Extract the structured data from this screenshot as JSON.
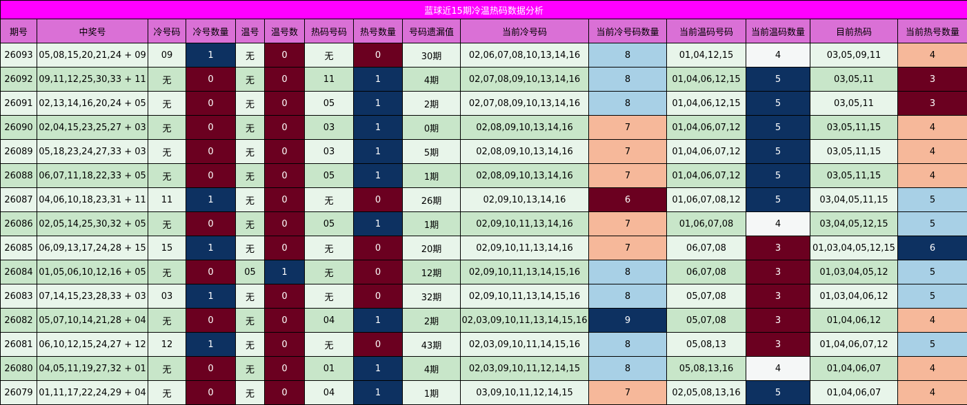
{
  "title": "蓝球近15期冷温热码数据分析",
  "headers": [
    "期号",
    "中奖号",
    "冷号码",
    "冷号数量",
    "温号",
    "温号数",
    "热码号码",
    "热号数量",
    "号码遗漏值",
    "当前冷号码",
    "当前冷号码数量",
    "当前温码号码",
    "当前温码数量",
    "目前热码",
    "当前热号数量"
  ],
  "colors": {
    "title_bar": "#ff00ff",
    "header_bar": "#da70d6",
    "row_light": "#e8f5ea",
    "row_alt": "#c8e6c9",
    "navy": "#0d3161",
    "maroon": "#6b0020",
    "light_blue": "#a8d0e6",
    "peach": "#f6b89a",
    "white": "#f5f7f7"
  },
  "rows": [
    {
      "issue": "26093",
      "draw": "05,08,15,20,21,24 + 09",
      "cold": "09",
      "cold_count": "1",
      "warm": "无",
      "warm_count": "0",
      "hot": "无",
      "hot_count": "0",
      "omit": "30期",
      "cur_cold": "02,06,07,08,10,13,14,16",
      "cur_cold_count": "8",
      "cur_warm": "01,04,12,15",
      "cur_warm_count": "4",
      "cur_hot": "03,05,09,11",
      "cur_hot_count": "4",
      "colors": {
        "cold_count": "navy",
        "warm_count": "maroon",
        "hot_count": "maroon",
        "cur_cold_count": "light",
        "cur_warm_count": "white",
        "cur_hot_count": "peach"
      }
    },
    {
      "issue": "26092",
      "draw": "09,11,12,25,30,33 + 11",
      "cold": "无",
      "cold_count": "0",
      "warm": "无",
      "warm_count": "0",
      "hot": "11",
      "hot_count": "1",
      "omit": "4期",
      "cur_cold": "02,07,08,09,10,13,14,16",
      "cur_cold_count": "8",
      "cur_warm": "01,04,06,12,15",
      "cur_warm_count": "5",
      "cur_hot": "03,05,11",
      "cur_hot_count": "3",
      "colors": {
        "cold_count": "maroon",
        "warm_count": "maroon",
        "hot_count": "navy",
        "cur_cold_count": "light",
        "cur_warm_count": "navy",
        "cur_hot_count": "maroon"
      }
    },
    {
      "issue": "26091",
      "draw": "02,13,14,16,20,24 + 05",
      "cold": "无",
      "cold_count": "0",
      "warm": "无",
      "warm_count": "0",
      "hot": "05",
      "hot_count": "1",
      "omit": "2期",
      "cur_cold": "02,07,08,09,10,13,14,16",
      "cur_cold_count": "8",
      "cur_warm": "01,04,06,12,15",
      "cur_warm_count": "5",
      "cur_hot": "03,05,11",
      "cur_hot_count": "3",
      "colors": {
        "cold_count": "maroon",
        "warm_count": "maroon",
        "hot_count": "navy",
        "cur_cold_count": "light",
        "cur_warm_count": "navy",
        "cur_hot_count": "maroon"
      }
    },
    {
      "issue": "26090",
      "draw": "02,04,15,23,25,27 + 03",
      "cold": "无",
      "cold_count": "0",
      "warm": "无",
      "warm_count": "0",
      "hot": "03",
      "hot_count": "1",
      "omit": "0期",
      "cur_cold": "02,08,09,10,13,14,16",
      "cur_cold_count": "7",
      "cur_warm": "01,04,06,07,12",
      "cur_warm_count": "5",
      "cur_hot": "03,05,11,15",
      "cur_hot_count": "4",
      "colors": {
        "cold_count": "maroon",
        "warm_count": "maroon",
        "hot_count": "navy",
        "cur_cold_count": "peach",
        "cur_warm_count": "navy",
        "cur_hot_count": "peach"
      }
    },
    {
      "issue": "26089",
      "draw": "05,18,23,24,27,33 + 03",
      "cold": "无",
      "cold_count": "0",
      "warm": "无",
      "warm_count": "0",
      "hot": "03",
      "hot_count": "1",
      "omit": "5期",
      "cur_cold": "02,08,09,10,13,14,16",
      "cur_cold_count": "7",
      "cur_warm": "01,04,06,07,12",
      "cur_warm_count": "5",
      "cur_hot": "03,05,11,15",
      "cur_hot_count": "4",
      "colors": {
        "cold_count": "maroon",
        "warm_count": "maroon",
        "hot_count": "navy",
        "cur_cold_count": "peach",
        "cur_warm_count": "navy",
        "cur_hot_count": "peach"
      }
    },
    {
      "issue": "26088",
      "draw": "06,07,11,18,22,33 + 05",
      "cold": "无",
      "cold_count": "0",
      "warm": "无",
      "warm_count": "0",
      "hot": "05",
      "hot_count": "1",
      "omit": "1期",
      "cur_cold": "02,08,09,10,13,14,16",
      "cur_cold_count": "7",
      "cur_warm": "01,04,06,07,12",
      "cur_warm_count": "5",
      "cur_hot": "03,05,11,15",
      "cur_hot_count": "4",
      "colors": {
        "cold_count": "maroon",
        "warm_count": "maroon",
        "hot_count": "navy",
        "cur_cold_count": "peach",
        "cur_warm_count": "navy",
        "cur_hot_count": "peach"
      }
    },
    {
      "issue": "26087",
      "draw": "04,06,10,18,23,31 + 11",
      "cold": "11",
      "cold_count": "1",
      "warm": "无",
      "warm_count": "0",
      "hot": "无",
      "hot_count": "0",
      "omit": "26期",
      "cur_cold": "02,09,10,13,14,16",
      "cur_cold_count": "6",
      "cur_warm": "01,06,07,08,12",
      "cur_warm_count": "5",
      "cur_hot": "03,04,05,11,15",
      "cur_hot_count": "5",
      "colors": {
        "cold_count": "navy",
        "warm_count": "maroon",
        "hot_count": "maroon",
        "cur_cold_count": "maroon",
        "cur_warm_count": "navy",
        "cur_hot_count": "light"
      }
    },
    {
      "issue": "26086",
      "draw": "02,05,14,25,30,32 + 05",
      "cold": "无",
      "cold_count": "0",
      "warm": "无",
      "warm_count": "0",
      "hot": "05",
      "hot_count": "1",
      "omit": "1期",
      "cur_cold": "02,09,10,11,13,14,16",
      "cur_cold_count": "7",
      "cur_warm": "01,06,07,08",
      "cur_warm_count": "4",
      "cur_hot": "03,04,05,12,15",
      "cur_hot_count": "5",
      "colors": {
        "cold_count": "maroon",
        "warm_count": "maroon",
        "hot_count": "navy",
        "cur_cold_count": "peach",
        "cur_warm_count": "white",
        "cur_hot_count": "light"
      }
    },
    {
      "issue": "26085",
      "draw": "06,09,13,17,24,28 + 15",
      "cold": "15",
      "cold_count": "1",
      "warm": "无",
      "warm_count": "0",
      "hot": "无",
      "hot_count": "0",
      "omit": "20期",
      "cur_cold": "02,09,10,11,13,14,16",
      "cur_cold_count": "7",
      "cur_warm": "06,07,08",
      "cur_warm_count": "3",
      "cur_hot": "01,03,04,05,12,15",
      "cur_hot_count": "6",
      "colors": {
        "cold_count": "navy",
        "warm_count": "maroon",
        "hot_count": "maroon",
        "cur_cold_count": "peach",
        "cur_warm_count": "maroon",
        "cur_hot_count": "navy"
      }
    },
    {
      "issue": "26084",
      "draw": "01,05,06,10,12,16 + 05",
      "cold": "无",
      "cold_count": "0",
      "warm": "05",
      "warm_count": "1",
      "hot": "无",
      "hot_count": "0",
      "omit": "12期",
      "cur_cold": "02,09,10,11,13,14,15,16",
      "cur_cold_count": "8",
      "cur_warm": "06,07,08",
      "cur_warm_count": "3",
      "cur_hot": "01,03,04,05,12",
      "cur_hot_count": "5",
      "colors": {
        "cold_count": "maroon",
        "warm_count": "navy",
        "hot_count": "maroon",
        "cur_cold_count": "light",
        "cur_warm_count": "maroon",
        "cur_hot_count": "light"
      }
    },
    {
      "issue": "26083",
      "draw": "07,14,15,23,28,33 + 03",
      "cold": "03",
      "cold_count": "1",
      "warm": "无",
      "warm_count": "0",
      "hot": "无",
      "hot_count": "0",
      "omit": "32期",
      "cur_cold": "02,09,10,11,13,14,15,16",
      "cur_cold_count": "8",
      "cur_warm": "05,07,08",
      "cur_warm_count": "3",
      "cur_hot": "01,03,04,06,12",
      "cur_hot_count": "5",
      "colors": {
        "cold_count": "navy",
        "warm_count": "maroon",
        "hot_count": "maroon",
        "cur_cold_count": "light",
        "cur_warm_count": "maroon",
        "cur_hot_count": "light"
      }
    },
    {
      "issue": "26082",
      "draw": "05,07,10,14,21,28 + 04",
      "cold": "无",
      "cold_count": "0",
      "warm": "无",
      "warm_count": "0",
      "hot": "04",
      "hot_count": "1",
      "omit": "2期",
      "cur_cold": "02,03,09,10,11,13,14,15,16",
      "cur_cold_count": "9",
      "cur_warm": "05,07,08",
      "cur_warm_count": "3",
      "cur_hot": "01,04,06,12",
      "cur_hot_count": "4",
      "colors": {
        "cold_count": "maroon",
        "warm_count": "maroon",
        "hot_count": "navy",
        "cur_cold_count": "navy",
        "cur_warm_count": "maroon",
        "cur_hot_count": "peach"
      }
    },
    {
      "issue": "26081",
      "draw": "06,10,12,15,24,27 + 12",
      "cold": "12",
      "cold_count": "1",
      "warm": "无",
      "warm_count": "0",
      "hot": "无",
      "hot_count": "0",
      "omit": "43期",
      "cur_cold": "02,03,09,10,11,14,15,16",
      "cur_cold_count": "8",
      "cur_warm": "05,08,13",
      "cur_warm_count": "3",
      "cur_hot": "01,04,06,07,12",
      "cur_hot_count": "5",
      "colors": {
        "cold_count": "navy",
        "warm_count": "maroon",
        "hot_count": "maroon",
        "cur_cold_count": "light",
        "cur_warm_count": "maroon",
        "cur_hot_count": "light"
      }
    },
    {
      "issue": "26080",
      "draw": "04,05,11,19,27,32 + 01",
      "cold": "无",
      "cold_count": "0",
      "warm": "无",
      "warm_count": "0",
      "hot": "01",
      "hot_count": "1",
      "omit": "4期",
      "cur_cold": "02,03,09,10,11,12,14,15",
      "cur_cold_count": "8",
      "cur_warm": "05,08,13,16",
      "cur_warm_count": "4",
      "cur_hot": "01,04,06,07",
      "cur_hot_count": "4",
      "colors": {
        "cold_count": "maroon",
        "warm_count": "maroon",
        "hot_count": "navy",
        "cur_cold_count": "light",
        "cur_warm_count": "white",
        "cur_hot_count": "peach"
      }
    },
    {
      "issue": "26079",
      "draw": "01,11,17,22,24,29 + 04",
      "cold": "无",
      "cold_count": "0",
      "warm": "无",
      "warm_count": "0",
      "hot": "04",
      "hot_count": "1",
      "omit": "1期",
      "cur_cold": "03,09,10,11,12,14,15",
      "cur_cold_count": "7",
      "cur_warm": "02,05,08,13,16",
      "cur_warm_count": "5",
      "cur_hot": "01,04,06,07",
      "cur_hot_count": "4",
      "colors": {
        "cold_count": "maroon",
        "warm_count": "maroon",
        "hot_count": "navy",
        "cur_cold_count": "peach",
        "cur_warm_count": "navy",
        "cur_hot_count": "peach"
      }
    }
  ]
}
